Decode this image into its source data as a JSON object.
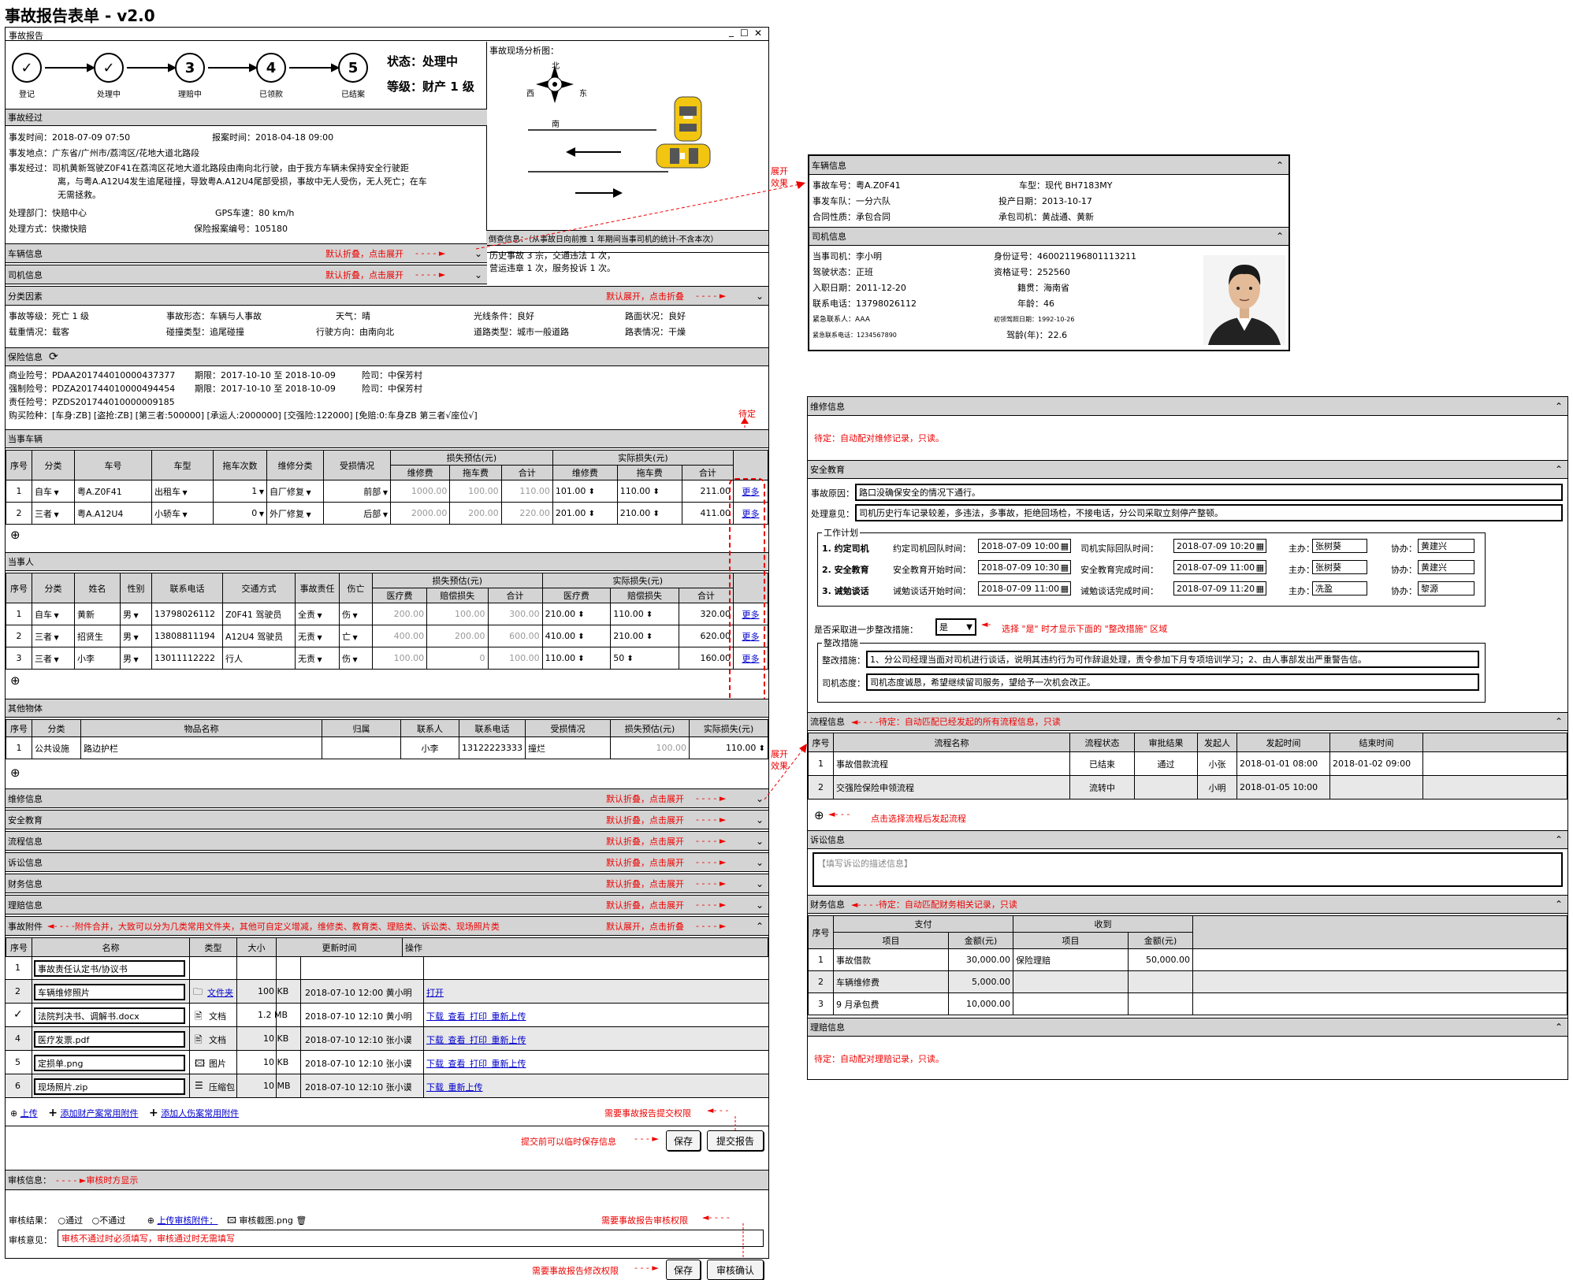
{
  "page_title": "事故报告表单 - v2.0",
  "window": {
    "title": "事故报告",
    "controls": [
      "_",
      "☐",
      "✕"
    ]
  },
  "progress": {
    "steps": [
      {
        "mark": "✓",
        "label": "登记"
      },
      {
        "mark": "✓",
        "label": "处理中"
      },
      {
        "mark": "3",
        "label": "理赔中"
      },
      {
        "mark": "4",
        "label": "已领款"
      },
      {
        "mark": "5",
        "label": "已结案"
      }
    ],
    "status": "状态：处理中",
    "grade": "等级：财产 1 级"
  },
  "process": {
    "header": "事故经过",
    "time": "事发时间：2018-07-09 07:50",
    "report_time": "报案时间：2018-04-18 09:00",
    "place": "事发地点：广东省/广州市/荔湾区/花地大道北路段",
    "desc_l1": "事发经过：司机黄新驾驶Z0F41在荔湾区花地大道北路段由南向北行驶，由于我方车辆未保持安全行驶距",
    "desc_l2": "离，与粤A.A12U4发生追尾碰撞，导致粤A.A12U4尾部受损，事故中无人受伤，无人死亡；在车",
    "desc_l3": "无需拯救。",
    "dept": "处理部门：快赔中心",
    "gps": "GPS车速：80 km/h",
    "method": "处理方式：快撤快赔",
    "insure_no": "保险报案编号：105180"
  },
  "scene": {
    "header": "事故现场分析图：",
    "north": "北",
    "south": "南",
    "west": "西",
    "east": "东",
    "note_header": "倒查信息：（从事故日向前推 1 年期间当事司机的统计-不含本次）",
    "note_l1": "历史事故 3 宗，交通违法 1 次，",
    "note_l2": "营运违章 1 次，服务投诉 1 次。"
  },
  "collapsed": {
    "vehicle": "车辆信息",
    "driver": "司机信息",
    "hint_fold": "默认折叠，点击展开",
    "hint_open": "默认展开，点击折叠"
  },
  "classify": {
    "header": "分类因素",
    "r1": [
      "事故等级：死亡 1 级",
      "事故形态：车辆与人事故",
      "天气：晴",
      "光线条件：良好",
      "路面状况：良好"
    ],
    "r2": [
      "载重情况：载客",
      "碰撞类型：追尾碰撞",
      "行驶方向：由南向北",
      "道路类型：城市一般道路",
      "路表情况：干燥"
    ]
  },
  "insurance": {
    "header": "保险信息",
    "l1a": "商业险号：PDAA201744010000437377",
    "l1b": "期限：2017-10-10 至 2018-10-09",
    "l1c": "险司：中保芳村",
    "l2a": "强制险号：PDZA201744010000494454",
    "l2b": "期限：2017-10-10 至 2018-10-09",
    "l2c": "险司：中保芳村",
    "l3": "责任险号：PZDS201744010000009185",
    "l4": "购买险种：[车身:ZB] [盗抢:ZB] [第三者:500000] [承运人:2000000] [交强险:122000] [免赔:0:车身ZB 第三者√座位√]"
  },
  "pending": "待定",
  "vehicles": {
    "header": "当事车辆",
    "cols": [
      "序号",
      "分类",
      "车号",
      "车型",
      "拖车次数",
      "维修分类",
      "受损情况"
    ],
    "g1": "损失预估(元)",
    "g2": "实际损失(元)",
    "sub": [
      "维修费",
      "拖车费",
      "合计",
      "维修费",
      "拖车费",
      "合计"
    ],
    "rows": [
      [
        "1",
        "自车",
        "粤A.Z0F41",
        "出租车",
        "1",
        "自厂修复",
        "前部",
        "1000.00",
        "100.00",
        "110.00",
        "101.00",
        "110.00",
        "211.00",
        "更多"
      ],
      [
        "2",
        "三者",
        "粤A.A12U4",
        "小轿车",
        "0",
        "外厂修复",
        "后部",
        "2000.00",
        "200.00",
        "220.00",
        "201.00",
        "210.00",
        "411.00",
        "更多"
      ]
    ],
    "add": "⊕"
  },
  "persons": {
    "header": "当事人",
    "cols": [
      "序号",
      "分类",
      "姓名",
      "性别",
      "联系电话",
      "交通方式",
      "事故责任",
      "伤亡"
    ],
    "g1": "损失预估(元)",
    "g2": "实际损失(元)",
    "sub": [
      "医疗费",
      "赔偿损失",
      "合计",
      "医疗费",
      "赔偿损失",
      "合计"
    ],
    "rows": [
      [
        "1",
        "自车",
        "黄新",
        "男",
        "13798026112",
        "Z0F41 驾驶员",
        "全责",
        "伤",
        "200.00",
        "100.00",
        "300.00",
        "210.00",
        "110.00",
        "320.00",
        "更多"
      ],
      [
        "2",
        "三者",
        "招贤生",
        "男",
        "13808811194",
        "A12U4 驾驶员",
        "无责",
        "亡",
        "400.00",
        "200.00",
        "600.00",
        "410.00",
        "210.00",
        "620.00",
        "更多"
      ],
      [
        "3",
        "三者",
        "小李",
        "男",
        "13011112222",
        "行人",
        "无责",
        "伤",
        "100.00",
        "0",
        "100.00",
        "110.00",
        "50",
        "160.00",
        "更多"
      ]
    ]
  },
  "others": {
    "header": "其他物体",
    "cols": [
      "序号",
      "分类",
      "物品名称",
      "归属",
      "联系人",
      "联系电话",
      "受损情况",
      "损失预估(元)",
      "实际损失(元)"
    ],
    "row": [
      "1",
      "公共设施",
      "路边护栏",
      "",
      "小李",
      "13122223333",
      "撞烂",
      "100.00",
      "110.00"
    ]
  },
  "folds": [
    "维修信息",
    "安全教育",
    "流程信息",
    "诉讼信息",
    "财务信息",
    "理赔信息"
  ],
  "attach": {
    "header": "事故附件",
    "note": "附件合并，大致可以分为几类常用文件夹，其他可自定义增减，维修类、教育类、理赔类、诉讼类、现场照片类",
    "cols": [
      "序号",
      "名称",
      "类型",
      "大小",
      "更新时间",
      "操作"
    ],
    "rows": [
      [
        "1",
        "事故责任认定书/协议书",
        "",
        "",
        "",
        ""
      ],
      [
        "2",
        "车辆维修照片",
        "文件夹",
        "100 KB",
        "2018-07-10 12:00 黄小明",
        "打开"
      ],
      [
        "✓",
        "法院判决书、调解书.docx",
        "文档",
        "1.2 MB",
        "2018-07-10 12:10 黄小明",
        "下载 查看 打印 重新上传"
      ],
      [
        "4",
        "医疗发票.pdf",
        "文档",
        "10 KB",
        "2018-07-10 12:10 张小谟",
        "下载 查看 打印 重新上传"
      ],
      [
        "5",
        "定损单.png",
        "图片",
        "10 KB",
        "2018-07-10 12:10 张小谟",
        "下载 查看 打印 重新上传"
      ],
      [
        "6",
        "现场照片.zip",
        "压缩包",
        "10 MB",
        "2018-07-10 12:10 张小谟",
        "下载 重新上传"
      ]
    ],
    "upload": "上传",
    "add1": "添加财产案常用附件",
    "add2": "添加人伤案常用附件",
    "perm_submit": "需要事故报告提交权限",
    "save_note": "提交前可以临时保存信息",
    "save": "保存",
    "submit": "提交报告"
  },
  "audit": {
    "header": "审核信息：",
    "note": "审核时方显示",
    "result": "审核结果：",
    "pass": "通过",
    "fail": "不通过",
    "upload": "上传审核附件：",
    "file": "审核截图.png",
    "perm": "需要事故报告审核权限",
    "opinion": "审核意见：",
    "placeholder": "审核不通过时必须填写，审核通过时无需填写",
    "perm_edit": "需要事故报告修改权限",
    "save": "保存",
    "confirm": "审核确认"
  },
  "expand": "展开效果",
  "vpanel": {
    "vehicle_header": "车辆信息",
    "r1a": "事故车号：粤A.Z0F41",
    "r1b": "车型：现代 BH7183MY",
    "r2a": "事发车队：一分六队",
    "r2b": "投产日期：2013-10-17",
    "r3a": "合同性质：承包合同",
    "r3b": "承包司机：黄战通、黄新",
    "driver_header": "司机信息",
    "d1a": "当事司机：李小明",
    "d1b": "身份证号：460021196801113211",
    "d2a": "驾驶状态：正班",
    "d2b": "资格证号：252560",
    "d3a": "入职日期：2011-12-20",
    "d3b": "籍贯：海南省",
    "d4a": "联系电话：13798026112",
    "d4b": "年龄：46",
    "d5a": "紧急联系人：AAA",
    "d5b": "初领驾照日期：1992-10-26",
    "d6a": "紧急联系电话：1234567890",
    "d6b": "驾龄(年)：22.6"
  },
  "rpanel": {
    "repair": "维修信息",
    "repair_note": "待定：自动配对维修记录，只读。",
    "edu": "安全教育",
    "cause_label": "事故原因：",
    "cause": "路口没确保安全的情况下通行。",
    "opinion_label": "处理意见：",
    "opinion": "司机历史行车记录较差，多违法，多事故，拒绝回场检，不接电话，分公司采取立刻停产整顿。",
    "plan": "工作计划",
    "plan_rows": [
      [
        "1. 约定司机",
        "约定司机回队时间：",
        "2018-07-09 10:00",
        "司机实际回队时间：",
        "2018-07-09 10:20",
        "主办：",
        "张树葵",
        "协办：",
        "黄建兴"
      ],
      [
        "2. 安全教育",
        "安全教育开始时间：",
        "2018-07-09 10:30",
        "安全教育完成时间：",
        "2018-07-09 11:00",
        "主办：",
        "张树葵",
        "协办：",
        "黄建兴"
      ],
      [
        "3. 诫勉谈话",
        "诫勉谈话开始时间：",
        "2018-07-09 11:00",
        "诫勉谈话完成时间：",
        "2018-07-09 11:20",
        "主办：",
        "冼盈",
        "协办：",
        "黎源"
      ]
    ],
    "further": "是否采取进一步整改措施：",
    "yes": "是",
    "further_note": "选择 \"是\" 时才显示下面的 \"整改措施\" 区域",
    "measures": "整改措施",
    "m_label": "整改措施：",
    "m_text": "1、分公司经理当面对司机进行谈话，说明其违约行为可作辞退处理，责令参加下月专项培训学习；2、由人事部发出严重警告信。",
    "att_label": "司机态度：",
    "att_text": "司机态度诚恳，希望继续留司服务，望给予一次机会改正。",
    "flow": "流程信息",
    "flow_note": "待定：自动匹配已经发起的所有流程信息，只读",
    "flow_cols": [
      "序号",
      "流程名称",
      "流程状态",
      "审批结果",
      "发起人",
      "发起时间",
      "结束时间"
    ],
    "flow_rows": [
      [
        "1",
        "事故借款流程",
        "已结束",
        "通过",
        "小张",
        "2018-01-01 08:00",
        "2018-01-02 09:00"
      ],
      [
        "2",
        "交强险保险申领流程",
        "流转中",
        "",
        "小明",
        "2018-01-05 10:00",
        ""
      ]
    ],
    "flow_add": "点击选择流程后发起流程",
    "lit": "诉讼信息",
    "lit_ph": "【填写诉讼的描述信息】",
    "fin": "财务信息",
    "fin_note": "待定：自动匹配财务相关记录，只读",
    "fin_pay": "支付",
    "fin_recv": "收到",
    "fin_cols": [
      "序号",
      "项目",
      "金额(元)",
      "项目",
      "金额(元)"
    ],
    "fin_rows": [
      [
        "1",
        "事故借款",
        "30,000.00",
        "保险理赔",
        "50,000.00"
      ],
      [
        "2",
        "车辆维修费",
        "5,000.00",
        "",
        ""
      ],
      [
        "3",
        "9 月承包费",
        "10,000.00",
        "",
        ""
      ]
    ],
    "claim": "理赔信息",
    "claim_note": "待定：自动配对理赔记录，只读。"
  }
}
